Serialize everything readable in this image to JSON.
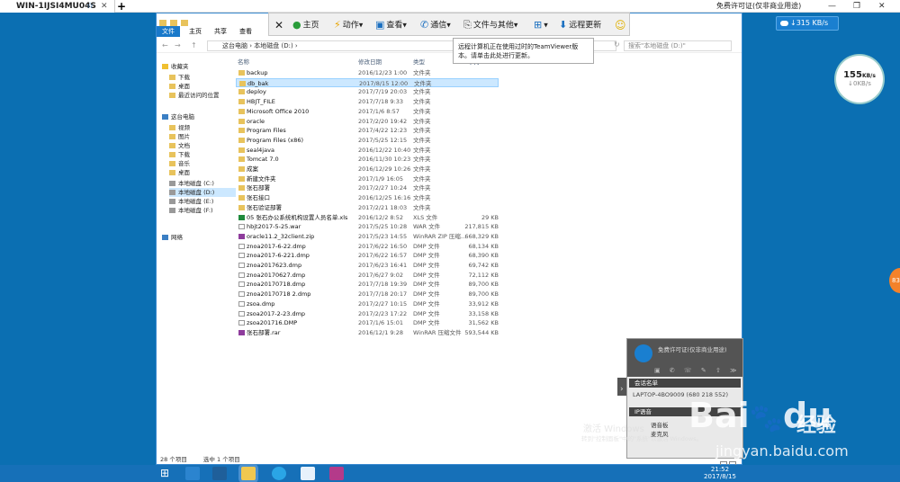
{
  "tab": {
    "title": "WIN-1IJSI4MU04S",
    "star": "☆",
    "close": "✕",
    "new_tab": "+"
  },
  "license_text": "免费许可证(仅非商业用途)",
  "window_controls": {
    "minimize": "—",
    "restore": "❐",
    "close": "✕"
  },
  "speed_widget": {
    "text": "↓315 KB/s"
  },
  "gauge": {
    "value": "155",
    "unit": "KB/s",
    "sub": "↓0KB/s"
  },
  "orange_badge": "83",
  "teamviewer_toolbar": {
    "close": "✕",
    "home": "主页",
    "actions": "动作",
    "view": "查看",
    "communicate": "通信",
    "files": "文件与其他",
    "update": "远程更新",
    "smiley": "☺",
    "dropdown": "▾"
  },
  "tooltip": "远程计算机正在使用过时的TeamViewer版本。请单击此处进行更新。",
  "explorer": {
    "ribbon_tabs": [
      "文件",
      "主页",
      "共享",
      "查看"
    ],
    "nav_back": "←",
    "nav_forward": "→",
    "nav_up": "↑",
    "nav_refresh": "↻",
    "address": "这台电脑 › 本地磁盘 (D:) ›",
    "search_placeholder": "搜索\"本地磁盘 (D:)\"",
    "sidebar": [
      {
        "label": "收藏夹",
        "type": "fav"
      },
      {
        "label": "下载",
        "type": "folder"
      },
      {
        "label": "桌面",
        "type": "folder"
      },
      {
        "label": "最近访问的位置",
        "type": "folder"
      },
      {
        "label": "这台电脑",
        "type": "pc"
      },
      {
        "label": "视频",
        "type": "folder"
      },
      {
        "label": "图片",
        "type": "folder"
      },
      {
        "label": "文档",
        "type": "folder"
      },
      {
        "label": "下载",
        "type": "folder"
      },
      {
        "label": "音乐",
        "type": "folder"
      },
      {
        "label": "桌面",
        "type": "folder"
      },
      {
        "label": "本地磁盘 (C:)",
        "type": "drive"
      },
      {
        "label": "本地磁盘 (D:)",
        "type": "drive",
        "selected": true
      },
      {
        "label": "本地磁盘 (E:)",
        "type": "drive"
      },
      {
        "label": "本地磁盘 (F:)",
        "type": "drive"
      },
      {
        "label": "网络",
        "type": "net"
      }
    ],
    "columns": {
      "name": "名称",
      "date": "修改日期",
      "type": "类型",
      "size": "大小"
    },
    "files": [
      {
        "name": "backup",
        "date": "2016/12/23 1:00",
        "type": "文件夹",
        "size": "",
        "kind": "folder"
      },
      {
        "name": "db_bak",
        "date": "2017/8/15 12:00",
        "type": "文件夹",
        "size": "",
        "kind": "folder",
        "selected": true
      },
      {
        "name": "deploy",
        "date": "2017/7/19 20:03",
        "type": "文件夹",
        "size": "",
        "kind": "folder"
      },
      {
        "name": "HBJT_FILE",
        "date": "2017/7/18 9:33",
        "type": "文件夹",
        "size": "",
        "kind": "folder"
      },
      {
        "name": "Microsoft Office 2010",
        "date": "2017/1/6 8:57",
        "type": "文件夹",
        "size": "",
        "kind": "folder"
      },
      {
        "name": "oracle",
        "date": "2017/2/20 19:42",
        "type": "文件夹",
        "size": "",
        "kind": "folder"
      },
      {
        "name": "Program Files",
        "date": "2017/4/22 12:23",
        "type": "文件夹",
        "size": "",
        "kind": "folder"
      },
      {
        "name": "Program Files (x86)",
        "date": "2017/5/25 12:15",
        "type": "文件夹",
        "size": "",
        "kind": "folder"
      },
      {
        "name": "seal4java",
        "date": "2016/12/22 10:40",
        "type": "文件夹",
        "size": "",
        "kind": "folder"
      },
      {
        "name": "Tomcat 7.0",
        "date": "2016/11/30 10:23",
        "type": "文件夹",
        "size": "",
        "kind": "folder"
      },
      {
        "name": "成案",
        "date": "2016/12/29 10:26",
        "type": "文件夹",
        "size": "",
        "kind": "folder"
      },
      {
        "name": "新建文件夹",
        "date": "2017/1/9 16:05",
        "type": "文件夹",
        "size": "",
        "kind": "folder"
      },
      {
        "name": "张石部署",
        "date": "2017/2/27 10:24",
        "type": "文件夹",
        "size": "",
        "kind": "folder"
      },
      {
        "name": "张石接口",
        "date": "2016/12/25 16:16",
        "type": "文件夹",
        "size": "",
        "kind": "folder"
      },
      {
        "name": "张石验证部署",
        "date": "2017/2/21 18:03",
        "type": "文件夹",
        "size": "",
        "kind": "folder"
      },
      {
        "name": "05 张石办公系统机构设置人员名单.xls",
        "date": "2016/12/2 8:52",
        "type": "XLS 文件",
        "size": "29 KB",
        "kind": "xls"
      },
      {
        "name": "hbjt2017-5-25.war",
        "date": "2017/5/25 10:28",
        "type": "WAR 文件",
        "size": "217,815 KB",
        "kind": "file"
      },
      {
        "name": "oracle11.2_32client.zip",
        "date": "2017/5/23 14:55",
        "type": "WinRAR ZIP 压缩...",
        "size": "668,329 KB",
        "kind": "zip"
      },
      {
        "name": "znoa2017-6-22.dmp",
        "date": "2017/6/22 16:50",
        "type": "DMP 文件",
        "size": "68,134 KB",
        "kind": "file"
      },
      {
        "name": "znoa2017-6-221.dmp",
        "date": "2017/6/22 16:57",
        "type": "DMP 文件",
        "size": "68,390 KB",
        "kind": "file"
      },
      {
        "name": "znoa2017623.dmp",
        "date": "2017/6/23 16:41",
        "type": "DMP 文件",
        "size": "69,742 KB",
        "kind": "file"
      },
      {
        "name": "znoa20170627.dmp",
        "date": "2017/6/27 9:02",
        "type": "DMP 文件",
        "size": "72,112 KB",
        "kind": "file"
      },
      {
        "name": "znoa20170718.dmp",
        "date": "2017/7/18 19:39",
        "type": "DMP 文件",
        "size": "89,700 KB",
        "kind": "file"
      },
      {
        "name": "znoa20170718 2.dmp",
        "date": "2017/7/18 20:17",
        "type": "DMP 文件",
        "size": "89,700 KB",
        "kind": "file"
      },
      {
        "name": "zsoa.dmp",
        "date": "2017/2/27 10:15",
        "type": "DMP 文件",
        "size": "33,912 KB",
        "kind": "file"
      },
      {
        "name": "zsoa2017-2-23.dmp",
        "date": "2017/2/23 17:22",
        "type": "DMP 文件",
        "size": "33,158 KB",
        "kind": "file"
      },
      {
        "name": "zsoa201716.DMP",
        "date": "2017/1/6 15:01",
        "type": "DMP 文件",
        "size": "31,562 KB",
        "kind": "file"
      },
      {
        "name": "张石部署.rar",
        "date": "2016/12/1 9:28",
        "type": "WinRAR 压缩文件",
        "size": "593,544 KB",
        "kind": "rar"
      }
    ],
    "status_count": "28 个项目",
    "status_selected": "选中 1 个项目"
  },
  "tv_panel": {
    "title": "免费许可证(仅非商业用途)",
    "icons": "▣ ✆ ☏ ✎ ⇧ ≫",
    "section1": "会话名单",
    "session": "LAPTOP-4BO9009 (680 218 552)",
    "section2": "IP语音",
    "voice1": "语音板",
    "voice2": "麦克风",
    "arrow": "›"
  },
  "activate": {
    "line1": "激活 Windows",
    "line2": "转到\"控制面板\"中的\"系统\"以激活 Windows。"
  },
  "watermark": {
    "brand": "Bai",
    "paw": "🐾",
    "brand2": "du",
    "cn": "经验",
    "url": "jingyan.baidu.com"
  },
  "taskbar": {
    "start": "⊞",
    "time": "21:52",
    "date": "2017/8/15"
  },
  "colors": {
    "accent": "#1979ca",
    "desktop": "#0b6fb2",
    "folder": "#e8c35c",
    "selection": "#cce8ff"
  }
}
